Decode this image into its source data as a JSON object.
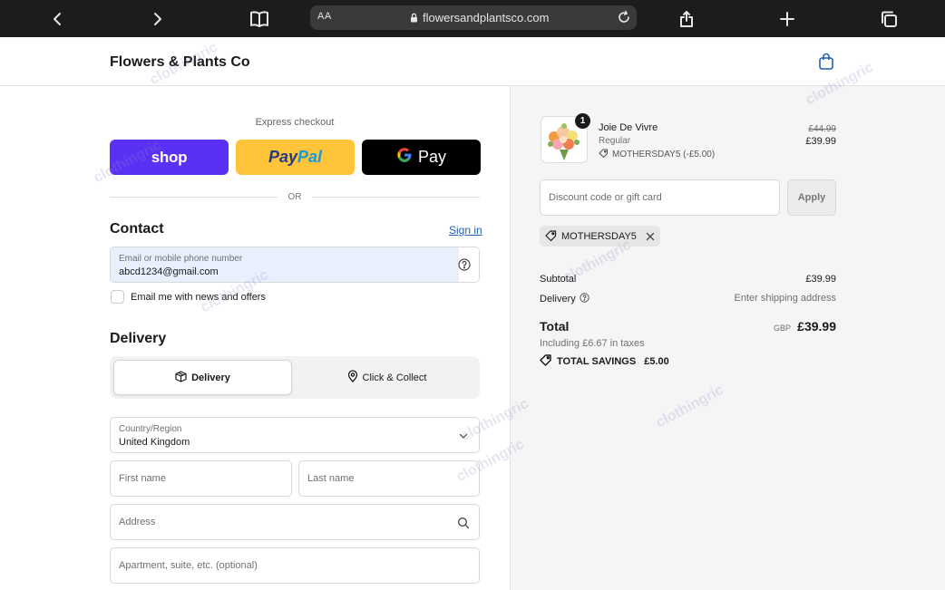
{
  "browser": {
    "url": "flowersandplantsco.com",
    "aa_label": "AA"
  },
  "header": {
    "brand": "Flowers & Plants Co"
  },
  "express": {
    "label": "Express checkout",
    "shop_label": "shop",
    "paypal_part1": "Pay",
    "paypal_part2": "Pal",
    "gpay_g": "G",
    "gpay_label": "Pay",
    "or_label": "OR"
  },
  "contact": {
    "title": "Contact",
    "signin": "Sign in",
    "email_label": "Email or mobile phone number",
    "email_value": "abcd1234@gmail.com",
    "news_label": "Email me with news and offers"
  },
  "delivery": {
    "title": "Delivery",
    "option_delivery": "Delivery",
    "option_collect": "Click & Collect",
    "country_label": "Country/Region",
    "country_value": "United Kingdom",
    "first_name_placeholder": "First name",
    "last_name_placeholder": "Last name",
    "address_placeholder": "Address",
    "apartment_placeholder": "Apartment, suite, etc. (optional)"
  },
  "summary": {
    "qty": "1",
    "product_name": "Joie De Vivre",
    "variant": "Regular",
    "discount_line": "MOTHERSDAY5 (-£5.00)",
    "price_old": "£44.99",
    "price_new": "£39.99",
    "discount_placeholder": "Discount code or gift card",
    "apply_label": "Apply",
    "code_chip": "MOTHERSDAY5",
    "subtotal_label": "Subtotal",
    "subtotal_value": "£39.99",
    "delivery_label": "Delivery",
    "delivery_value": "Enter shipping address",
    "total_label": "Total",
    "total_currency": "GBP",
    "total_value": "£39.99",
    "taxes": "Including £6.67 in taxes",
    "savings_label": "TOTAL SAVINGS",
    "savings_value": "£5.00"
  },
  "watermark": "clothingric",
  "colors": {
    "shop": "#5a31f4",
    "paypal": "#ffc439",
    "link": "#1f5fb4",
    "toolbar": "#1c1c1e"
  }
}
